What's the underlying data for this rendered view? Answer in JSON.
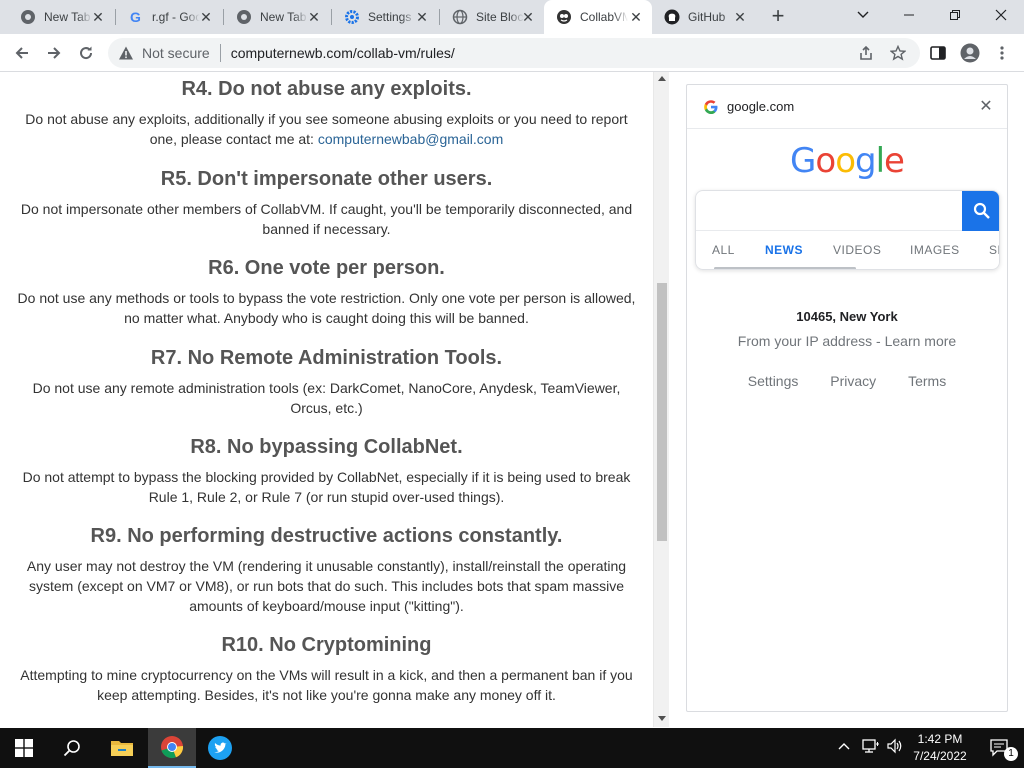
{
  "browser": {
    "tabs": [
      {
        "title": "New Tab",
        "icon": "chrome-icon"
      },
      {
        "title": "r.gf - Google",
        "icon": "google-g-icon"
      },
      {
        "title": "New Tab",
        "icon": "chrome-icon"
      },
      {
        "title": "Settings",
        "icon": "settings-gear-icon"
      },
      {
        "title": "Site Blocker",
        "icon": "globe-icon"
      },
      {
        "title": "CollabVM",
        "icon": "collabvm-icon"
      },
      {
        "title": "GitHub",
        "icon": "github-icon"
      }
    ],
    "new_tab_symbol": "+",
    "close_symbol": "✕",
    "security_label": "Not secure",
    "url": "computernewb.com/collab-vm/rules/"
  },
  "page": {
    "rules": [
      {
        "heading": "R4. Do not abuse any exploits.",
        "body": "Do not abuse any exploits, additionally if you see someone abusing exploits or you need to report one, please contact me at: ",
        "link": "computernewbab@gmail.com"
      },
      {
        "heading": "R5. Don't impersonate other users.",
        "body": "Do not impersonate other members of CollabVM. If caught, you'll be temporarily disconnected, and banned if necessary."
      },
      {
        "heading": "R6. One vote per person.",
        "body": "Do not use any methods or tools to bypass the vote restriction. Only one vote per person is allowed, no matter what. Anybody who is caught doing this will be banned."
      },
      {
        "heading": "R7. No Remote Administration Tools.",
        "body": "Do not use any remote administration tools (ex: DarkComet, NanoCore, Anydesk, TeamViewer, Orcus, etc.)"
      },
      {
        "heading": "R8. No bypassing CollabNet.",
        "body": "Do not attempt to bypass the blocking provided by CollabNet, especially if it is being used to break Rule 1, Rule 2, or Rule 7 (or run stupid over-used things)."
      },
      {
        "heading": "R9. No performing destructive actions constantly.",
        "body": "Any user may not destroy the VM (rendering it unusable constantly), install/reinstall the operating system (except on VM7 or VM8), or run bots that do such. This includes bots that spam massive amounts of keyboard/mouse input (\"kitting\")."
      },
      {
        "heading": "R10. No Cryptomining",
        "body": "Attempting to mine cryptocurrency on the VMs will result in a kick, and then a permanent ban if you keep attempting. Besides, it's not like you're gonna make any money off it."
      }
    ]
  },
  "side_panel": {
    "site": "google.com",
    "logo_letters": [
      "G",
      "o",
      "o",
      "g",
      "l",
      "e"
    ],
    "logo_colors": [
      "#4285F4",
      "#EA4335",
      "#FBBC05",
      "#4285F4",
      "#34A853",
      "#EA4335"
    ],
    "search_tabs": [
      "ALL",
      "NEWS",
      "VIDEOS",
      "IMAGES",
      "SHOPPING"
    ],
    "active_tab": "NEWS",
    "location": "10465, New York",
    "location_source": "From your IP address - Learn more",
    "footer_links": [
      "Settings",
      "Privacy",
      "Terms"
    ]
  },
  "taskbar": {
    "time": "1:42 PM",
    "date": "7/24/2022",
    "notification_count": "1",
    "apps": [
      "start-icon",
      "search-icon",
      "file-explorer-icon",
      "chrome-icon",
      "twitter-icon"
    ]
  },
  "colors": {
    "accent": "#1a73e8",
    "link": "#2a6496",
    "heading": "#555555"
  }
}
